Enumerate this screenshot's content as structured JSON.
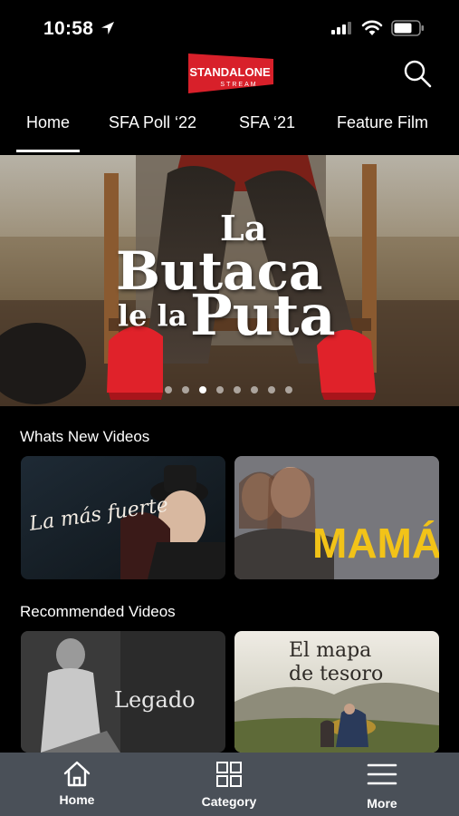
{
  "status": {
    "time": "10:58"
  },
  "header": {
    "logo_text": "STANDALONE",
    "logo_subtext": "STREAM"
  },
  "tabs": [
    {
      "label": "Home",
      "active": true
    },
    {
      "label": "SFA Poll ‘22",
      "active": false
    },
    {
      "label": "SFA ‘21",
      "active": false
    },
    {
      "label": "Feature Film",
      "active": false
    }
  ],
  "hero": {
    "title_line1": "La",
    "title_line2": "Butaca",
    "title_line3a": "le la",
    "title_line3b": "Puta",
    "slide_count": 8,
    "active_slide": 3
  },
  "sections": [
    {
      "title": "Whats New Videos",
      "items": [
        {
          "title_text": "La más fuerte"
        },
        {
          "title_text": "MAMÁ"
        }
      ]
    },
    {
      "title": "Recommended Videos",
      "items": [
        {
          "title_text": "Legado"
        },
        {
          "title_line1": "El mapa",
          "title_line2": "de tesoro"
        }
      ]
    }
  ],
  "bottom_nav": [
    {
      "label": "Home",
      "icon": "home-icon"
    },
    {
      "label": "Category",
      "icon": "grid-icon"
    },
    {
      "label": "More",
      "icon": "menu-icon"
    }
  ],
  "colors": {
    "logo_red": "#d8202a",
    "mama_yellow": "#f2c318",
    "nav_bg": "#4a5058"
  }
}
